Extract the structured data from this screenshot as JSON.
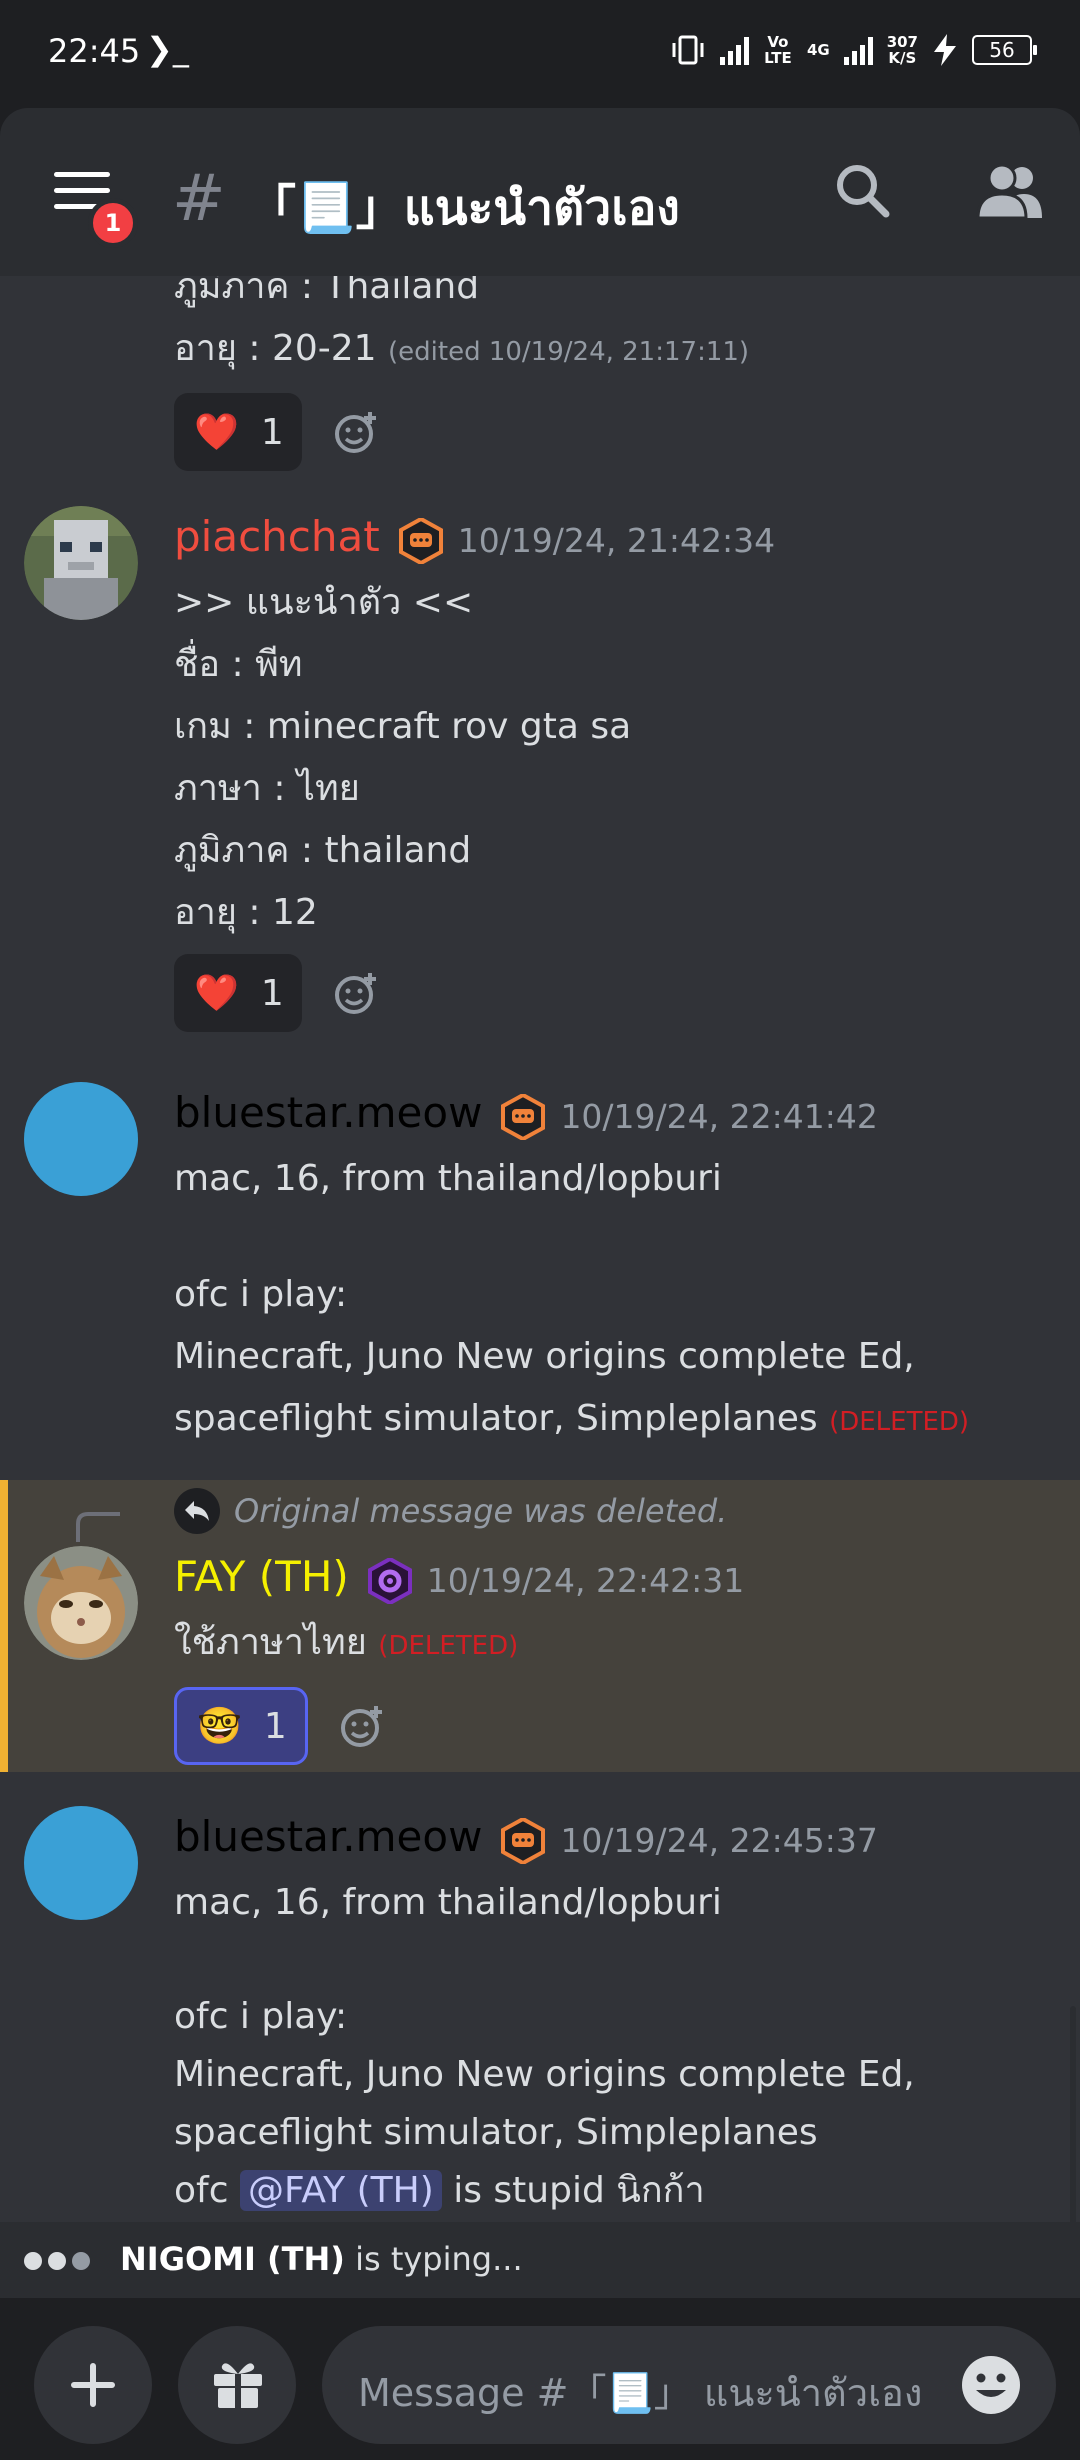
{
  "status_bar": {
    "time": "22:45",
    "terminal_glyph": "❯_",
    "volte": "Vo LTE",
    "network": "4G",
    "speed_value": "307",
    "speed_unit": "K/S",
    "battery": "56"
  },
  "header": {
    "menu_badge": "1",
    "hash": "#",
    "channel_name": "「📃」แนะนำตัวเอง"
  },
  "messages": [
    {
      "lines": [
        "ภูมิภาค : Thailand",
        "อายุ      : 20-21"
      ],
      "edited": "(edited 10/19/24, 21:17:11)",
      "reaction_emoji": "❤️",
      "reaction_count": "1"
    },
    {
      "username": "piachchat",
      "timestamp": "10/19/24, 21:42:34",
      "lines": [
        ">> แนะนำตัว <<",
        "ชื่อ        : พีท",
        "เกม       : minecraft rov gta sa",
        "ภาษา    : ไทย",
        "ภูมิภาค : thailand",
        "อายุ      : 12"
      ],
      "reaction_emoji": "❤️",
      "reaction_count": "1"
    },
    {
      "username": "bluestar.meow",
      "timestamp": "10/19/24, 22:41:42",
      "lines": [
        "mac, 16, from thailand/lopburi",
        "",
        "ofc i play:",
        "Minecraft, Juno New origins complete Ed,",
        "spaceflight simulator, Simpleplanes"
      ],
      "deleted_tag": "(DELETED)"
    },
    {
      "reply_text": "Original message was deleted.",
      "username": "FAY (TH)",
      "timestamp": "10/19/24, 22:42:31",
      "lines": [
        "ใช้ภาษาไทย"
      ],
      "deleted_tag": "(DELETED)",
      "reaction_emoji": "🤓",
      "reaction_count": "1"
    },
    {
      "username": "bluestar.meow",
      "timestamp": "10/19/24, 22:45:37",
      "lines": [
        "mac, 16, from thailand/lopburi",
        "",
        "ofc i play:",
        "Minecraft, Juno New origins complete Ed,",
        "spaceflight simulator, Simpleplanes"
      ],
      "last_line_prefix": "ofc ",
      "mention": "@FAY (TH)",
      "last_line_suffix": " is stupid นิกก้า"
    }
  ],
  "typing": {
    "user": "NIGOMI (TH)",
    "text": " is typing..."
  },
  "composer": {
    "placeholder": "Message #「📃」 แนะนำตัวเอง"
  },
  "colors": {
    "piachchat": "#f04d3f",
    "bluestar": "#000000",
    "fay": "#f5f000",
    "highlight_bar": "#f0b132"
  },
  "icons": [
    "menu-icon",
    "search-icon",
    "members-icon",
    "add-reaction-icon",
    "reply-icon",
    "plus-icon",
    "gift-icon",
    "emoji-icon"
  ]
}
